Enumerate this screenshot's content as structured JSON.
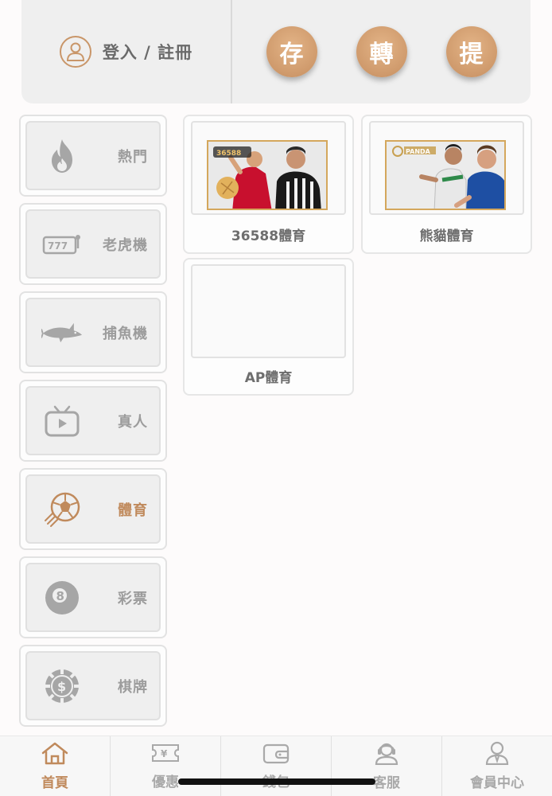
{
  "header": {
    "login_label": "登入 / 註冊",
    "actions": [
      {
        "label": "存"
      },
      {
        "label": "轉"
      },
      {
        "label": "提"
      }
    ]
  },
  "categories": [
    {
      "label": "熱門",
      "icon": "fire-icon"
    },
    {
      "label": "老虎機",
      "icon": "slot-machine-icon"
    },
    {
      "label": "捕魚機",
      "icon": "shark-icon"
    },
    {
      "label": "真人",
      "icon": "live-tv-icon"
    },
    {
      "label": "體育",
      "icon": "soccer-ball-icon"
    },
    {
      "label": "彩票",
      "icon": "billiard-8-ball-icon"
    },
    {
      "label": "棋牌",
      "icon": "casino-chip-icon"
    }
  ],
  "active_category": "體育",
  "games": [
    {
      "name": "36588體育"
    },
    {
      "name": "熊貓體育"
    },
    {
      "name": "AP體育"
    }
  ],
  "bottom_nav": [
    {
      "label": "首頁",
      "icon": "home-icon"
    },
    {
      "label": "優惠",
      "icon": "voucher-icon"
    },
    {
      "label": "錢包",
      "icon": "wallet-icon"
    },
    {
      "label": "客服",
      "icon": "customer-service-icon"
    },
    {
      "label": "會員中心",
      "icon": "member-icon"
    }
  ],
  "colors": {
    "accent": "#c08a5c",
    "inactive": "#a9a9a9",
    "panel": "#efefef"
  }
}
